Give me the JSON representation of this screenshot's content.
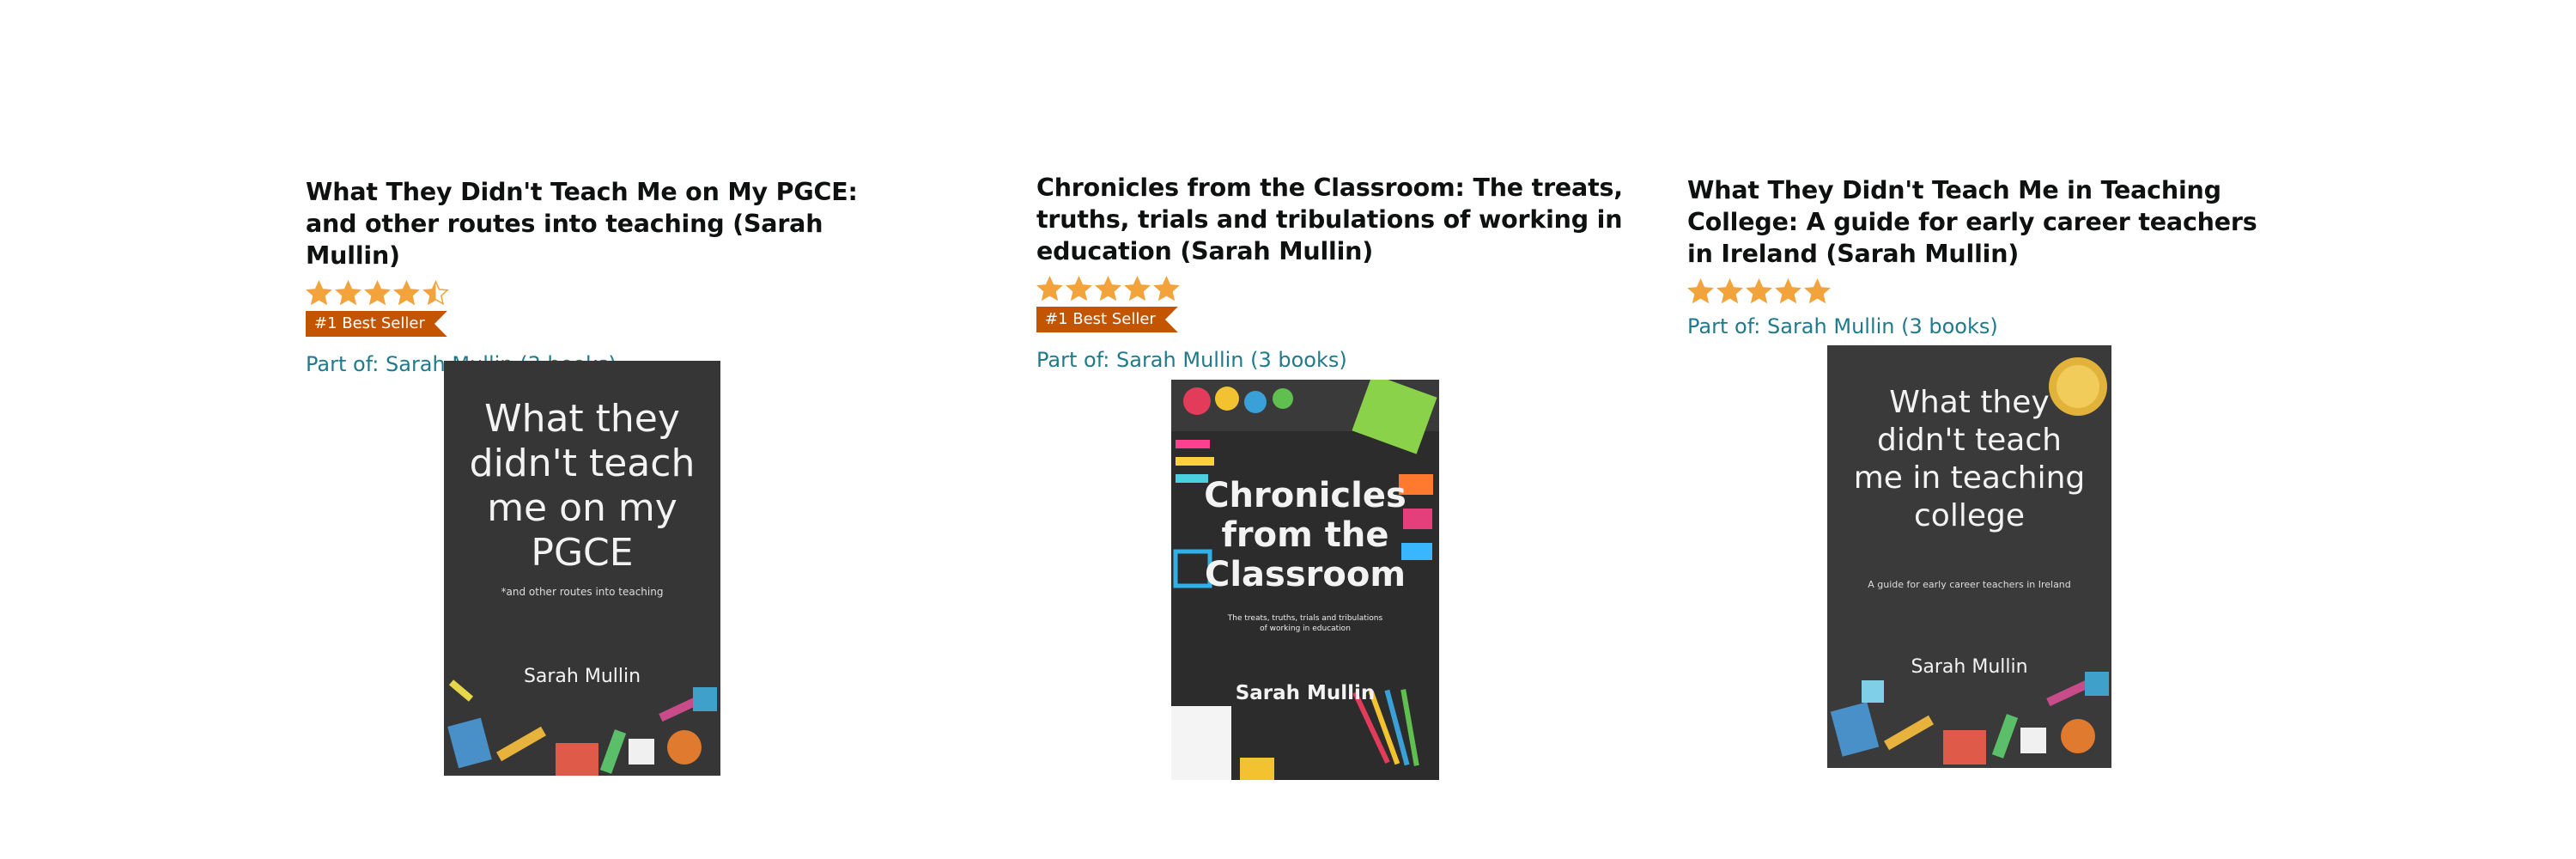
{
  "colors": {
    "title": "#0f1111",
    "link": "#1f7a8c",
    "star": "#f3a33b",
    "badge": "#c45500",
    "chalkboard": "#3a3a3a"
  },
  "books": [
    {
      "title": "What They Didn't Teach Me on My PGCE: and other routes into teaching (Sarah Mullin)",
      "rating": 4.5,
      "badge": "#1 Best Seller",
      "series": "Part of: Sarah Mullin (3 books)",
      "cover": {
        "main": "What they\ndidn't teach\nme on my\nPGCE",
        "sub": "*and other routes into teaching",
        "author": "Sarah Mullin"
      }
    },
    {
      "title": "Chronicles from the Classroom: The treats, truths, trials and tribulations of working in education (Sarah Mullin)",
      "rating": 5,
      "badge": "#1 Best Seller",
      "series": "Part of: Sarah Mullin (3 books)",
      "cover": {
        "main": "Chronicles\nfrom the\nClassroom",
        "sub": "The treats, truths, trials and tribulations\nof working in education",
        "author": "Sarah Mullin"
      }
    },
    {
      "title": "What They Didn't Teach Me in Teaching College: A guide for early career teachers in Ireland (Sarah Mullin)",
      "rating": 5,
      "badge": "",
      "series": "Part of: Sarah Mullin (3 books)",
      "cover": {
        "main": "What they\ndidn't teach\nme in teaching\ncollege",
        "sub": "A guide for early career teachers in Ireland",
        "author": "Sarah Mullin"
      }
    }
  ]
}
